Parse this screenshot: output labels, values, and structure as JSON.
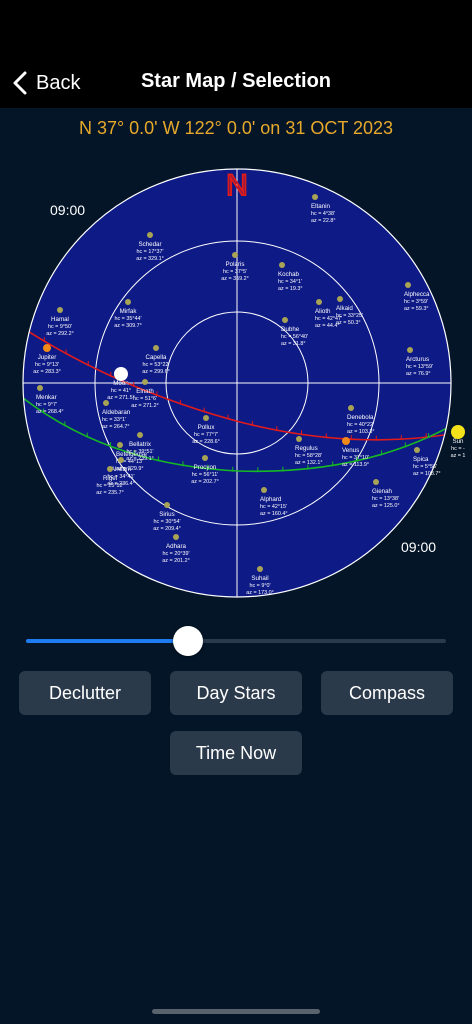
{
  "nav": {
    "back_label": "Back",
    "title": "Star Map / Selection"
  },
  "location_line": "N 37° 0.0' W 122° 0.0' on 31 OCT 2023",
  "time_marks": {
    "left": "09:00",
    "right": "09:00"
  },
  "compass_label": "N",
  "colors": {
    "sky": "#0E1A86",
    "grid": "#FFFFFF",
    "ecliptic": "#E01B1B",
    "equator": "#16B823",
    "accent": "#E7A92B",
    "star": "#A8A355"
  },
  "bodies": [
    {
      "name": "Jupiter",
      "hc": "hc = 9°13'",
      "az": "az = 283.3°"
    },
    {
      "name": "Moon",
      "hc": "hc = 41°",
      "az": "az = 271.5°"
    },
    {
      "name": "Venus",
      "hc": "hc = 37°10'",
      "az": "az = 113.9°"
    },
    {
      "name": "Sun",
      "hc": "hc = -",
      "az": "az = 1"
    }
  ],
  "stars": [
    {
      "name": "Eltanin",
      "hc": "hc = 4°38'",
      "az": "az = 22.8°"
    },
    {
      "name": "Schedar",
      "hc": "hc = 17°37'",
      "az": "az = 329.1°"
    },
    {
      "name": "Polaris",
      "hc": "hc = 37°5'",
      "az": "az = 359.2°"
    },
    {
      "name": "Kochab",
      "hc": "hc = 34°1'",
      "az": "az = 19.3°"
    },
    {
      "name": "Hamal",
      "hc": "hc = 9°50'",
      "az": "az = 292.2°"
    },
    {
      "name": "Mirfak",
      "hc": "hc = 35°44'",
      "az": "az = 309.7°"
    },
    {
      "name": "Alioth",
      "hc": "hc = 42°47'",
      "az": "az = 44.4°"
    },
    {
      "name": "Alkaid",
      "hc": "hc = 33°25'",
      "az": "az = 50.3°"
    },
    {
      "name": "Alphecca",
      "hc": "hc = 3°59'",
      "az": "az = 59.3°"
    },
    {
      "name": "Dubhe",
      "hc": "hc = 56°40'",
      "az": "az = 31.8°"
    },
    {
      "name": "Capella",
      "hc": "hc = 53°22'",
      "az": "az = 299.6°"
    },
    {
      "name": "Arcturus",
      "hc": "hc = 13°59'",
      "az": "az = 76.9°"
    },
    {
      "name": "Menkar",
      "hc": "hc = 9°7'",
      "az": "az = 268.4°"
    },
    {
      "name": "Aldebaran",
      "hc": "hc = 33°1'",
      "az": "az = 264.7°"
    },
    {
      "name": "Elnath",
      "hc": "hc = 51°6'",
      "az": "az = 271.2°"
    },
    {
      "name": "Pollux",
      "hc": "hc = 77°7'",
      "az": "az = 228.6°"
    },
    {
      "name": "Denebola",
      "hc": "hc = 40°22'",
      "az": "az = 103.3°"
    },
    {
      "name": "Regulus",
      "hc": "hc = 58°28'",
      "az": "az = 132.1°"
    },
    {
      "name": "Bellatrix",
      "hc": "hc = 39°51'",
      "az": "az = 239.1°"
    },
    {
      "name": "Betelgeuse",
      "hc": "hc = 44°13'",
      "az": "az = 229.9°"
    },
    {
      "name": "Alnilam",
      "hc": "hc = 34°41'",
      "az": "az = 236.4°"
    },
    {
      "name": "Rigel",
      "hc": "hc = 25°52'",
      "az": "az = 235.7°"
    },
    {
      "name": "Procyon",
      "hc": "hc = 56°11'",
      "az": "az = 202.7°"
    },
    {
      "name": "Spica",
      "hc": "hc = 5°56'",
      "az": "az = 108.7°"
    },
    {
      "name": "Gienah",
      "hc": "hc = 13°38'",
      "az": "az = 125.0°"
    },
    {
      "name": "Alphard",
      "hc": "hc = 42°15'",
      "az": "az = 160.4°"
    },
    {
      "name": "Sirius",
      "hc": "hc = 30°54'",
      "az": "az = 209.4°"
    },
    {
      "name": "Adhara",
      "hc": "hc = 20°39'",
      "az": "az = 201.2°"
    },
    {
      "name": "Suhail",
      "hc": "hc = 9°0'",
      "az": "az = 173.0°"
    }
  ],
  "slider": {
    "value_fraction": 0.385
  },
  "buttons": {
    "declutter": "Declutter",
    "day_stars": "Day Stars",
    "compass": "Compass",
    "time_now": "Time Now"
  }
}
